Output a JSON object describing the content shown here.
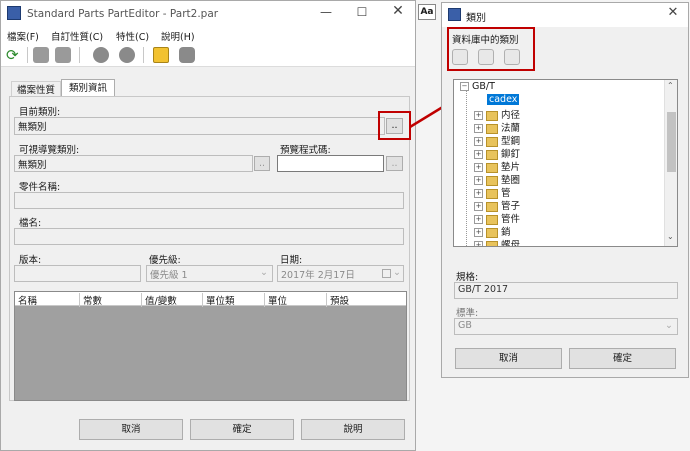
{
  "main_window": {
    "title": "Standard Parts PartEditor - Part2.par",
    "menu": [
      "檔案(F)",
      "自訂性質(C)",
      "特性(C)",
      "說明(H)"
    ],
    "tabs": [
      "檔案性質",
      "類別資訊"
    ],
    "labels": {
      "current_category": "目前類別:",
      "visible_nav_category": "可視導覽類別:",
      "preview_code": "預覽程式碼:",
      "part_name": "零件名稱:",
      "file_name": "檔名:",
      "version": "版本:",
      "priority": "優先級:",
      "date": "日期:"
    },
    "values": {
      "current_category": "無類別",
      "visible_nav_category": "無類別",
      "priority": "優先級 1",
      "date": "2017年  2月17日"
    },
    "browse_label": "..",
    "table_headers": [
      "名稱",
      "常數",
      "值/變數",
      "單位類",
      "單位",
      "預設"
    ],
    "buttons": {
      "cancel": "取消",
      "ok": "確定",
      "help": "說明"
    }
  },
  "category_dialog": {
    "title": "類別",
    "group_label": "資料庫中的類別",
    "tree_root": "GB/T",
    "tree_items": [
      "cadex",
      "内径",
      "法蘭",
      "型鋼",
      "鉚釘",
      "墊片",
      "墊圈",
      "管",
      "管子",
      "管件",
      "銷",
      "螺母"
    ],
    "spec_label": "規格:",
    "spec_value": "GB/T 2017",
    "standard_label": "標準:",
    "standard_value": "GB",
    "buttons": {
      "cancel": "取消",
      "ok": "確定"
    }
  },
  "colors": {
    "highlight": "#c00000",
    "selection": "#0078d7"
  }
}
